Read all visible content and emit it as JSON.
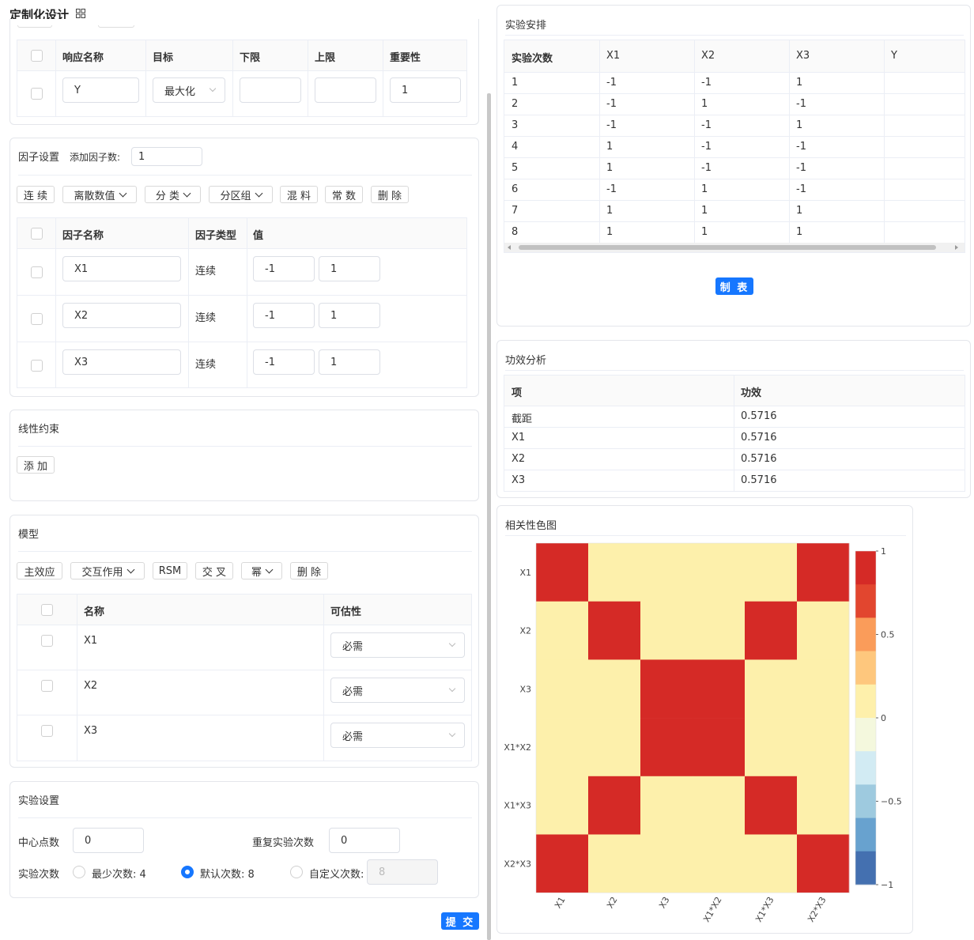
{
  "header": {
    "title": "定制化设计",
    "grid_icon": "grid-icon"
  },
  "response": {
    "columns": [
      "响应名称",
      "目标",
      "下限",
      "上限",
      "重要性"
    ],
    "row": {
      "name": "Y",
      "goal": "最大化",
      "lower": "",
      "upper": "",
      "importance": "1"
    }
  },
  "factors": {
    "title": "因子设置",
    "add_label": "添加因子数:",
    "add_value": "1",
    "buttons": [
      "连 续",
      "离散数值",
      "分 类",
      "分区组",
      "混 料",
      "常 数",
      "删 除"
    ],
    "columns": [
      "因子名称",
      "因子类型",
      "值"
    ],
    "rows": [
      {
        "name": "X1",
        "type": "连续",
        "low": "-1",
        "high": "1"
      },
      {
        "name": "X2",
        "type": "连续",
        "low": "-1",
        "high": "1"
      },
      {
        "name": "X3",
        "type": "连续",
        "low": "-1",
        "high": "1"
      }
    ]
  },
  "constraints": {
    "title": "线性约束",
    "add_button": "添 加"
  },
  "model": {
    "title": "模型",
    "buttons": [
      "主效应",
      "交互作用",
      "RSM",
      "交 叉",
      "幂",
      "删 除"
    ],
    "columns": [
      "名称",
      "可估性"
    ],
    "rows": [
      {
        "name": "X1",
        "estimability": "必需"
      },
      {
        "name": "X2",
        "estimability": "必需"
      },
      {
        "name": "X3",
        "estimability": "必需"
      }
    ]
  },
  "experiment": {
    "title": "实验设置",
    "center_label": "中心点数",
    "center_value": "0",
    "repeat_label": "重复实验次数",
    "repeat_value": "0",
    "runs_label": "实验次数",
    "options": [
      "最少次数: 4",
      "默认次数: 8",
      "自定义次数:"
    ],
    "selected": 1,
    "custom_placeholder": "8",
    "submit": "提 交"
  },
  "schedule": {
    "title": "实验安排",
    "columns": [
      "实验次数",
      "X1",
      "X2",
      "X3",
      "Y"
    ],
    "rows": [
      [
        "1",
        "-1",
        "-1",
        "1",
        ""
      ],
      [
        "2",
        "-1",
        "1",
        "-1",
        ""
      ],
      [
        "3",
        "-1",
        "-1",
        "1",
        ""
      ],
      [
        "4",
        "1",
        "-1",
        "-1",
        ""
      ],
      [
        "5",
        "1",
        "-1",
        "-1",
        ""
      ],
      [
        "6",
        "-1",
        "1",
        "-1",
        ""
      ],
      [
        "7",
        "1",
        "1",
        "1",
        ""
      ],
      [
        "8",
        "1",
        "1",
        "1",
        ""
      ]
    ],
    "make_button": "制 表"
  },
  "power": {
    "title": "功效分析",
    "columns": [
      "项",
      "功效"
    ],
    "rows": [
      [
        "截距",
        "0.5716"
      ],
      [
        "X1",
        "0.5716"
      ],
      [
        "X2",
        "0.5716"
      ],
      [
        "X3",
        "0.5716"
      ]
    ]
  },
  "heatmap": {
    "title": "相关性色图"
  },
  "chart_data": {
    "type": "heatmap",
    "x_labels": [
      "X1",
      "X2",
      "X3",
      "X1*X2",
      "X1*X3",
      "X2*X3"
    ],
    "y_labels": [
      "X1",
      "X2",
      "X3",
      "X1*X2",
      "X1*X3",
      "X2*X3"
    ],
    "values": [
      [
        1,
        0,
        0,
        0,
        0,
        1
      ],
      [
        0,
        1,
        0,
        0,
        1,
        0
      ],
      [
        0,
        0,
        1,
        1,
        0,
        0
      ],
      [
        0,
        0,
        1,
        1,
        0,
        0
      ],
      [
        0,
        1,
        0,
        0,
        1,
        0
      ],
      [
        1,
        0,
        0,
        0,
        0,
        1
      ]
    ],
    "colorbar": {
      "min": -1,
      "max": 1,
      "ticks": [
        "1",
        "0.5",
        "0",
        "−0.5",
        "−1"
      ]
    },
    "palette": [
      "#4575b4",
      "#74add1",
      "#abd9e9",
      "#e0f3f8",
      "#ffffbf",
      "#fee090",
      "#fdae61",
      "#f46d43",
      "#d73027"
    ],
    "colors": {
      "high": "#d52a26",
      "zero": "#fdf0ab"
    }
  }
}
